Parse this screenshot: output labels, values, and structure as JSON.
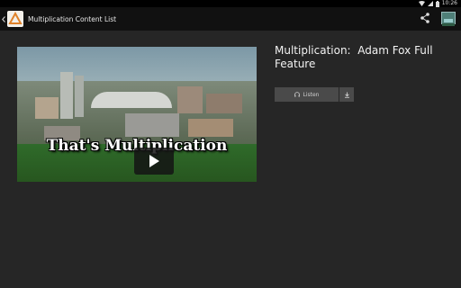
{
  "status_bar": {
    "time": "10:26",
    "icons": [
      "wifi-icon",
      "signal-icon",
      "battery-icon"
    ]
  },
  "action_bar": {
    "title": "Multiplication Content List",
    "icons": [
      "back-icon",
      "app-logo",
      "share-icon",
      "thumbnail-icon"
    ]
  },
  "video": {
    "overlay_text": "That's Multiplication",
    "icons": [
      "play-icon"
    ]
  },
  "details": {
    "title": "Multiplication:  Adam Fox Full Feature",
    "listen_label": "Listen",
    "icons": [
      "headphones-icon",
      "download-icon"
    ]
  },
  "colors": {
    "background": "#262626",
    "action_bar": "#111111",
    "button": "#4a4a4a"
  }
}
